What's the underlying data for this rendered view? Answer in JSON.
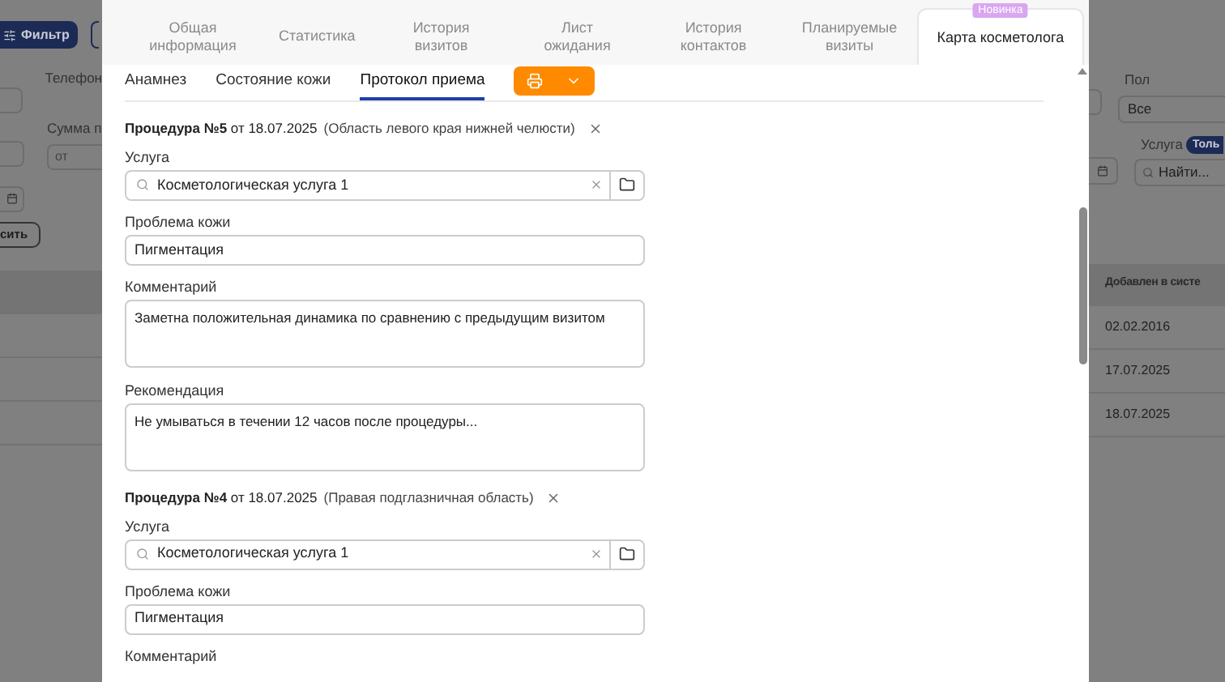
{
  "background": {
    "left": {
      "filter_button": "Фильтр",
      "phone_label": "Телефон",
      "sum_label": "Сумма п",
      "sum_placeholder": "от",
      "reset_button": "сить"
    },
    "right": {
      "gender_label": "Пол",
      "gender_value": "Все",
      "service_label": "Услуга",
      "service_badge": "Толь",
      "service_placeholder": "Найти...",
      "table_header": "Добавлен в систе",
      "dates": [
        "02.02.2016",
        "17.07.2025",
        "18.07.2025"
      ]
    }
  },
  "modal": {
    "tabs": [
      {
        "label": "Общая информация",
        "selected": false
      },
      {
        "label": "Статистика",
        "selected": false
      },
      {
        "label": "История визитов",
        "selected": false
      },
      {
        "label": "Лист ожидания",
        "selected": false
      },
      {
        "label": "История контактов",
        "selected": false
      },
      {
        "label": "Планируемые визиты",
        "selected": false
      },
      {
        "label": "Карта косметолога",
        "selected": true,
        "badge": "Новинка"
      }
    ],
    "subtabs": [
      {
        "label": "Анамнез",
        "selected": false
      },
      {
        "label": "Состояние кожи",
        "selected": false
      },
      {
        "label": "Протокол приема",
        "selected": true
      }
    ],
    "procedures": [
      {
        "title": "**Процедура №5** от 18.07.2025",
        "area": "(Область левого края нижней челюсти)",
        "fields": [
          {
            "kind": "search",
            "label": "Услуга",
            "value": "Косметологическая услуга 1"
          },
          {
            "kind": "input",
            "label": "Проблема кожи",
            "value": "Пигментация"
          },
          {
            "kind": "textarea",
            "label": "Комментарий",
            "value": "Заметна положительная динамика по сравнению с предыдущим визитом"
          },
          {
            "kind": "textarea",
            "label": "Рекомендация",
            "value": "Не умываться в течении 12 часов после процедуры..."
          }
        ]
      },
      {
        "title": "**Процедура №4** от 18.07.2025",
        "area": "(Правая подглазничная область)",
        "fields": [
          {
            "kind": "search",
            "label": "Услуга",
            "value": "Косметологическая услуга 1"
          },
          {
            "kind": "input",
            "label": "Проблема кожи",
            "value": "Пигментация"
          },
          {
            "kind": "label",
            "label": "Комментарий"
          }
        ]
      }
    ]
  }
}
